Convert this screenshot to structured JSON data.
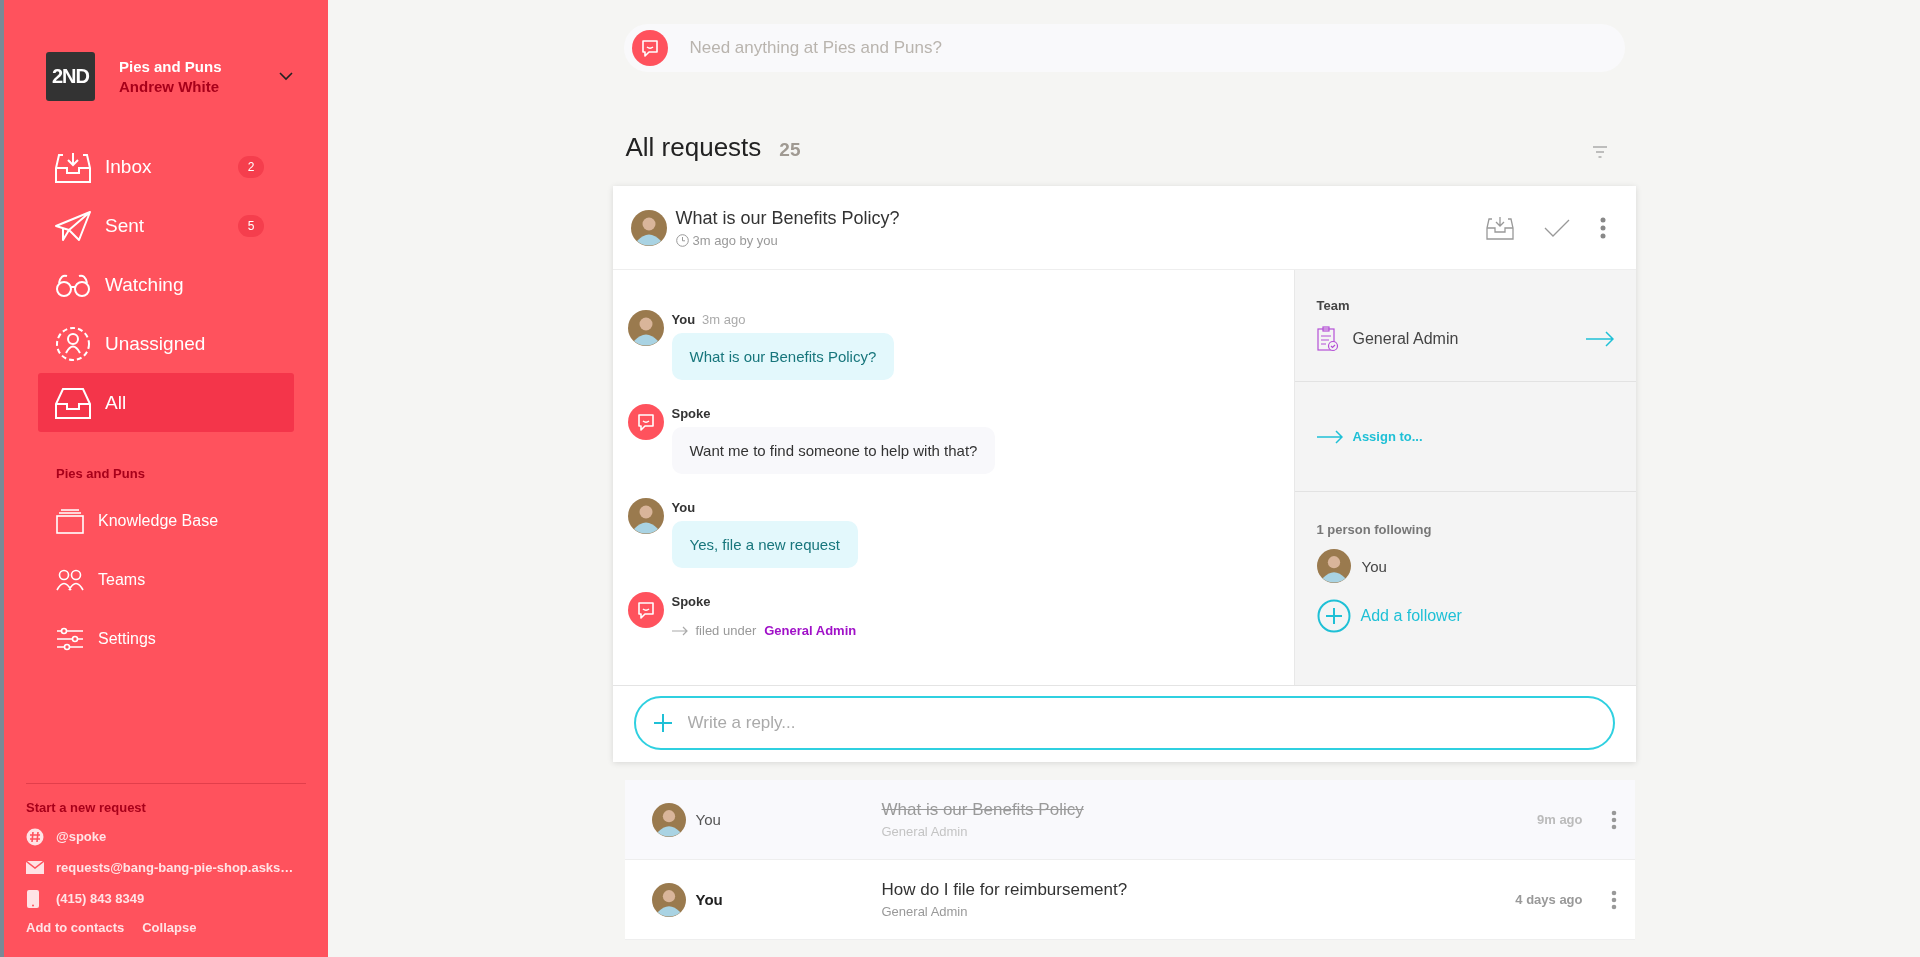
{
  "workspace": {
    "logo": "2ND",
    "org": "Pies and Puns",
    "user": "Andrew White"
  },
  "nav": [
    {
      "label": "Inbox",
      "badge": "2",
      "selected": false
    },
    {
      "label": "Sent",
      "badge": "5",
      "selected": false
    },
    {
      "label": "Watching",
      "selected": false
    },
    {
      "label": "Unassigned",
      "selected": false
    },
    {
      "label": "All",
      "selected": true
    }
  ],
  "section": {
    "title": "Pies and Puns",
    "items": [
      {
        "label": "Knowledge Base"
      },
      {
        "label": "Teams"
      },
      {
        "label": "Settings"
      }
    ]
  },
  "new_request": {
    "title": "Start a new request",
    "channels": [
      {
        "kind": "slack",
        "text": "@spoke"
      },
      {
        "kind": "email",
        "text": "requests@bang-bang-pie-shop.asks…"
      },
      {
        "kind": "phone",
        "text": "(415) 843 8349"
      }
    ],
    "links": [
      "Add to contacts",
      "Collapse"
    ]
  },
  "search": {
    "placeholder": "Need anything at Pies and Puns?"
  },
  "heading": {
    "title": "All requests",
    "count": "25"
  },
  "request": {
    "title": "What is our Benefits Policy?",
    "meta": "3m ago by you",
    "messages": [
      {
        "kind": "user",
        "sender": "You",
        "time": "3m ago",
        "text": "What is our Benefits Policy?"
      },
      {
        "kind": "bot",
        "sender": "Spoke",
        "text": "Want me to find someone to help with that?"
      },
      {
        "kind": "user",
        "sender": "You",
        "text": "Yes, file a new request"
      },
      {
        "kind": "event",
        "sender": "Spoke",
        "text": "filed under",
        "link": "General Admin"
      }
    ],
    "team": {
      "label": "Team",
      "name": "General Admin"
    },
    "assign": "Assign to...",
    "followers": {
      "title": "1 person following",
      "people": [
        "You"
      ],
      "add": "Add a follower"
    },
    "reply_placeholder": "Write a reply..."
  },
  "list": [
    {
      "author": "You",
      "title": "What is our Benefits Policy",
      "team": "General Admin",
      "time": "9m ago",
      "resolved": true
    },
    {
      "author": "You",
      "title": "How do I file for reimbursement?",
      "team": "General Admin",
      "time": "4 days ago",
      "resolved": false
    }
  ]
}
